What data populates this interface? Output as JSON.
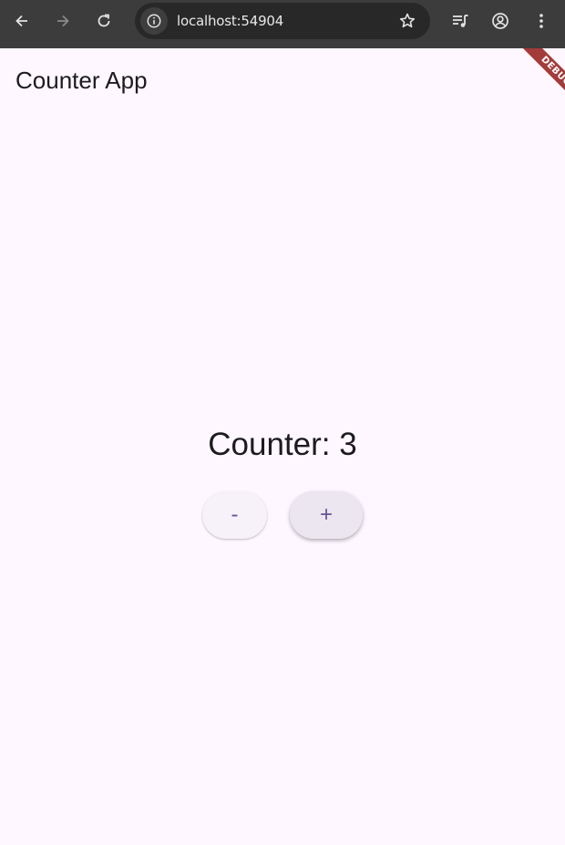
{
  "browser": {
    "url": "localhost:54904",
    "icons": {
      "back": "arrow-left-icon",
      "forward": "arrow-right-icon",
      "reload": "reload-icon",
      "site_info": "info-icon",
      "bookmark": "star-icon",
      "media": "media-queue-icon",
      "profile": "account-icon",
      "menu": "kebab-menu-icon"
    }
  },
  "app": {
    "title": "Counter App",
    "debug_label": "DEBUG",
    "counter_text": "Counter: 3",
    "decrement_label": "-",
    "increment_label": "+"
  },
  "colors": {
    "background": "#fef7ff",
    "chrome": "#3c3c3c",
    "accent": "#65558f",
    "debug": "#a33b3b"
  }
}
